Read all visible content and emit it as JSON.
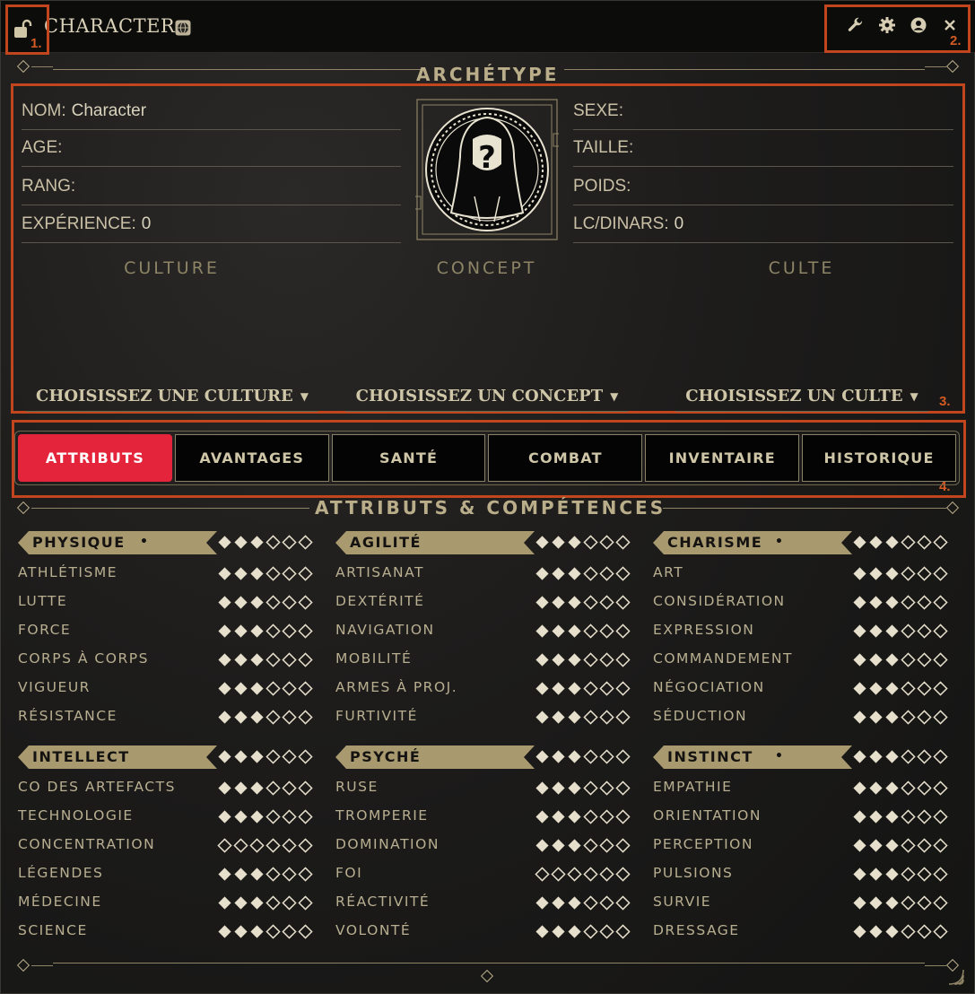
{
  "window": {
    "title": "CHARACTER"
  },
  "annotations": [
    "1.",
    "2.",
    "3.",
    "4."
  ],
  "icons": {
    "lock": "lock-open-icon",
    "globe": "globe-icon",
    "wrench": "wrench-icon",
    "gear": "gear-icon",
    "user": "user-circle-icon",
    "close": "close-icon",
    "resize": "resize-handle-icon"
  },
  "archetype": {
    "section_title": "ARCHÉTYPE",
    "left_fields": [
      {
        "label": "NOM:",
        "value": "Character"
      },
      {
        "label": "AGE:",
        "value": ""
      },
      {
        "label": "RANG:",
        "value": ""
      },
      {
        "label": "EXPÉRIENCE:",
        "value": "0"
      }
    ],
    "right_fields": [
      {
        "label": "SEXE:",
        "value": ""
      },
      {
        "label": "TAILLE:",
        "value": ""
      },
      {
        "label": "POIDS:",
        "value": ""
      },
      {
        "label": "LC/DINARS:",
        "value": "0"
      }
    ],
    "columns": [
      "CULTURE",
      "CONCEPT",
      "CULTE"
    ],
    "choosers": [
      "CHOISISSEZ UNE CULTURE",
      "CHOISISSEZ UN CONCEPT",
      "CHOISISSEZ UN CULTE"
    ],
    "portrait_glyph": "?"
  },
  "tabs": [
    {
      "label": "ATTRIBUTS",
      "active": true
    },
    {
      "label": "AVANTAGES",
      "active": false
    },
    {
      "label": "SANTÉ",
      "active": false
    },
    {
      "label": "COMBAT",
      "active": false
    },
    {
      "label": "INVENTAIRE",
      "active": false
    },
    {
      "label": "HISTORIQUE",
      "active": false
    }
  ],
  "attributes": {
    "section_title": "ATTRIBUTS & COMPÉTENCES",
    "groups": [
      {
        "name": "PHYSIQUE",
        "marked": true,
        "value": 3,
        "skills": [
          {
            "name": "ATHLÉTISME",
            "value": 3
          },
          {
            "name": "LUTTE",
            "value": 3
          },
          {
            "name": "FORCE",
            "value": 3
          },
          {
            "name": "CORPS À CORPS",
            "value": 3
          },
          {
            "name": "VIGUEUR",
            "value": 3
          },
          {
            "name": "RÉSISTANCE",
            "value": 3
          }
        ]
      },
      {
        "name": "AGILITÉ",
        "marked": false,
        "value": 3,
        "skills": [
          {
            "name": "ARTISANAT",
            "value": 3
          },
          {
            "name": "DEXTÉRITÉ",
            "value": 3
          },
          {
            "name": "NAVIGATION",
            "value": 3
          },
          {
            "name": "MOBILITÉ",
            "value": 3
          },
          {
            "name": "ARMES À PROJ.",
            "value": 3
          },
          {
            "name": "FURTIVITÉ",
            "value": 3
          }
        ]
      },
      {
        "name": "CHARISME",
        "marked": true,
        "value": 3,
        "skills": [
          {
            "name": "ART",
            "value": 3
          },
          {
            "name": "CONSIDÉRATION",
            "value": 3
          },
          {
            "name": "EXPRESSION",
            "value": 3
          },
          {
            "name": "COMMANDEMENT",
            "value": 3
          },
          {
            "name": "NÉGOCIATION",
            "value": 3
          },
          {
            "name": "SÉDUCTION",
            "value": 3
          }
        ]
      },
      {
        "name": "INTELLECT",
        "marked": false,
        "value": 3,
        "skills": [
          {
            "name": "CO DES ARTEFACTS",
            "value": 3
          },
          {
            "name": "TECHNOLOGIE",
            "value": 3
          },
          {
            "name": "CONCENTRATION",
            "value": 0
          },
          {
            "name": "LÉGENDES",
            "value": 3
          },
          {
            "name": "MÉDECINE",
            "value": 3
          },
          {
            "name": "SCIENCE",
            "value": 3
          }
        ]
      },
      {
        "name": "PSYCHÉ",
        "marked": false,
        "value": 3,
        "skills": [
          {
            "name": "RUSE",
            "value": 3
          },
          {
            "name": "TROMPERIE",
            "value": 3
          },
          {
            "name": "DOMINATION",
            "value": 3
          },
          {
            "name": "FOI",
            "value": 0
          },
          {
            "name": "RÉACTIVITÉ",
            "value": 3
          },
          {
            "name": "VOLONTÉ",
            "value": 3
          }
        ]
      },
      {
        "name": "INSTINCT",
        "marked": true,
        "value": 3,
        "skills": [
          {
            "name": "EMPATHIE",
            "value": 3
          },
          {
            "name": "ORIENTATION",
            "value": 3
          },
          {
            "name": "PERCEPTION",
            "value": 3
          },
          {
            "name": "PULSIONS",
            "value": 3
          },
          {
            "name": "SURVIE",
            "value": 3
          },
          {
            "name": "DRESSAGE",
            "value": 3
          }
        ]
      }
    ],
    "max_value": 6
  },
  "colors": {
    "accent": "#e4243b",
    "gold": "#b9ad8a",
    "banner": "#a8996f",
    "annotation": "#c2461d"
  }
}
